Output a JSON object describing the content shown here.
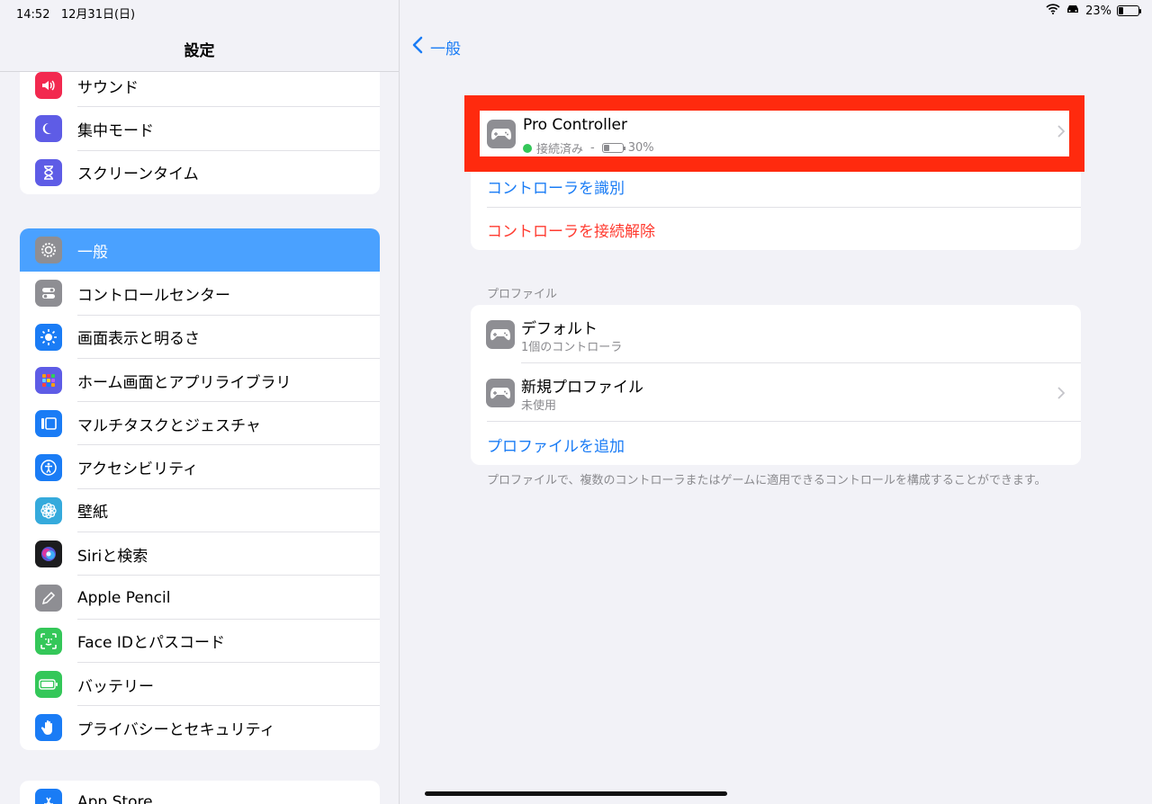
{
  "status": {
    "time": "14:52",
    "date": "12月31日(日)",
    "battery_percent": "23%"
  },
  "sidebar": {
    "title": "設定",
    "group1": [
      {
        "label": "サウンド",
        "icon": "speaker-icon",
        "color": "#f2294f"
      },
      {
        "label": "集中モード",
        "icon": "moon-icon",
        "color": "#5e5ce6"
      },
      {
        "label": "スクリーンタイム",
        "icon": "hourglass-icon",
        "color": "#5e5ce6"
      }
    ],
    "group2": [
      {
        "label": "一般",
        "icon": "gear-icon",
        "color": "#8e8e93",
        "selected": true
      },
      {
        "label": "コントロールセンター",
        "icon": "toggles-icon",
        "color": "#8e8e93"
      },
      {
        "label": "画面表示と明るさ",
        "icon": "sun-icon",
        "color": "#1a7cf5"
      },
      {
        "label": "ホーム画面とアプリライブラリ",
        "icon": "grid-icon",
        "color": "#5e5ce6"
      },
      {
        "label": "マルチタスクとジェスチャ",
        "icon": "multitask-icon",
        "color": "#1a7cf5"
      },
      {
        "label": "アクセシビリティ",
        "icon": "accessibility-icon",
        "color": "#1a7cf5"
      },
      {
        "label": "壁紙",
        "icon": "flower-icon",
        "color": "#35aadc"
      },
      {
        "label": "Siriと検索",
        "icon": "siri-icon",
        "color": "#222"
      },
      {
        "label": "Apple Pencil",
        "icon": "pencil-icon",
        "color": "#8e8e93"
      },
      {
        "label": "Face IDとパスコード",
        "icon": "faceid-icon",
        "color": "#34c759"
      },
      {
        "label": "バッテリー",
        "icon": "battery-icon",
        "color": "#34c759"
      },
      {
        "label": "プライバシーとセキュリティ",
        "icon": "hand-icon",
        "color": "#1a7cf5"
      }
    ],
    "group3": [
      {
        "label": "App Store",
        "icon": "appstore-icon",
        "color": "#1a7cf5"
      }
    ]
  },
  "nav": {
    "back_label": "一般"
  },
  "controller": {
    "name": "Pro Controller",
    "status": "接続済み",
    "dash": "-",
    "battery": "30%",
    "identify": "コントローラを識別",
    "disconnect": "コントローラを接続解除"
  },
  "profiles": {
    "section_label": "プロファイル",
    "items": [
      {
        "name": "デフォルト",
        "detail": "1個のコントローラ"
      },
      {
        "name": "新規プロファイル",
        "detail": "未使用"
      }
    ],
    "add_label": "プロファイルを追加",
    "footnote": "プロファイルで、複数のコントローラまたはゲームに適用できるコントロールを構成することができます。"
  },
  "colors": {
    "accent": "#1a7cf5",
    "destructive": "#ff3b30",
    "highlight": "#ff2a0e",
    "selected": "#4aa1ff"
  }
}
